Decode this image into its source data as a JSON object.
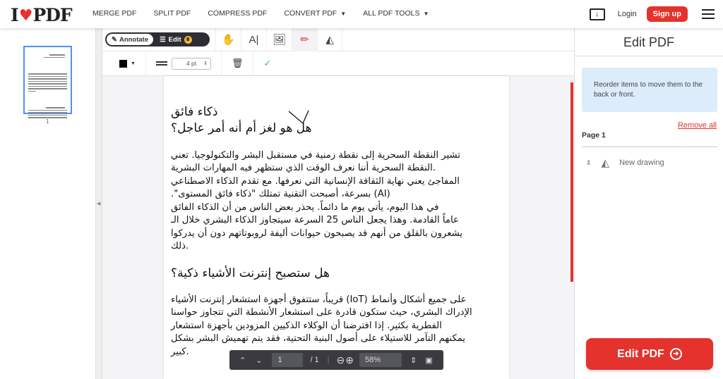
{
  "header": {
    "logo": "I♥PDF",
    "nav": [
      "MERGE PDF",
      "SPLIT PDF",
      "COMPRESS PDF",
      "CONVERT PDF",
      "ALL PDF TOOLS"
    ],
    "login": "Login",
    "signup": "Sign up"
  },
  "sidebar": {
    "page_number": "1"
  },
  "toolbar": {
    "annotate": "Annotate",
    "edit": "Edit",
    "stroke_width": "4 pt"
  },
  "document": {
    "title_lines": [
      "ذكاء فائق",
      "هل هو لغز أم أنه أمر عاجل؟"
    ],
    "para1": [
      "تشير النقطة السحرية إلى نقطة زمنية في مستقبل البشر والتكنولوجيا. تعني",
      ".النقطة السحرية أننا نعرف الوقت الذي ستظهر فيه المهارات البشرية",
      "المفاجئ يعني نهاية الثقافة الإنسانية التي نعرفها. مع تقدم الذكاء الاصطناعي",
      "(AI) بسرعة، أصبحت التقنية تمتلك \"ذكاء فائق المستوى\".",
      "في هذا اليوم، يأتي يوم ما دائماً. يحذر بعض الناس من أن الذكاء الفائق",
      "عاماً القادمة. وهذا يجعل الناس 25 السرعة سيتجاوز الذكاء البشري خلال الـ",
      "يشعرون بالقلق من أنهم قد يصبحون حيوانات أليفة لروبوتاتهم دون أن يدركوا",
      ".ذلك"
    ],
    "heading2": "هل ستصبح إنترنت الأشياء ذكية؟",
    "para2": [
      "على جميع أشكال وأنماط (IoT) قريباً، ستتفوق أجهزة استشعار إنترنت الأشياء",
      "الإدراك البشري، حيث ستكون قادرة على استشعار الأنشطة التي تتجاوز حواسنا",
      "الفطرية بكثير. إذا افترضنا أن الوكلاء الذكيين المزودين بأجهزة استشعار",
      "يمكنهم التآمر للاستيلاء على أصول البنية التحتية، فقد يتم تهميش البشر بشكل",
      ".كبير"
    ]
  },
  "pager": {
    "current_page": "1",
    "total": "/ 1",
    "zoom": "58%"
  },
  "panel": {
    "title": "Edit PDF",
    "info": "Reorder items to move them to the back or front.",
    "remove_all": "Remove all",
    "page_label": "Page 1",
    "item": "New drawing",
    "button": "Edit PDF"
  },
  "colors": {
    "accent": "#e5322d",
    "info_bg": "#dcecfb"
  }
}
